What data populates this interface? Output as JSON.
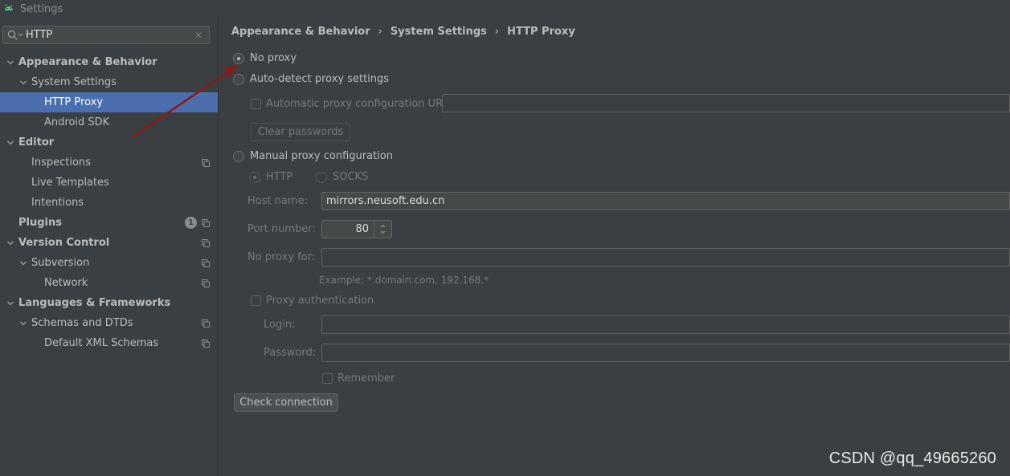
{
  "window": {
    "title": "Settings"
  },
  "search": {
    "value": "HTTP"
  },
  "tree": [
    {
      "label": "Appearance & Behavior",
      "level": 0,
      "expand": "open",
      "bold": true
    },
    {
      "label": "System Settings",
      "level": 1,
      "expand": "open",
      "bold": false
    },
    {
      "label": "HTTP Proxy",
      "level": 2,
      "expand": "none",
      "bold": false,
      "selected": true
    },
    {
      "label": "Android SDK",
      "level": 2,
      "expand": "none",
      "bold": false
    },
    {
      "label": "Editor",
      "level": 0,
      "expand": "open",
      "bold": true
    },
    {
      "label": "Inspections",
      "level": 1,
      "expand": "none",
      "bold": false,
      "copy": true
    },
    {
      "label": "Live Templates",
      "level": 1,
      "expand": "none",
      "bold": false
    },
    {
      "label": "Intentions",
      "level": 1,
      "expand": "none",
      "bold": false
    },
    {
      "label": "Plugins",
      "level": 0,
      "expand": "none",
      "bold": true,
      "copy": true,
      "badge": "1"
    },
    {
      "label": "Version Control",
      "level": 0,
      "expand": "open",
      "bold": true,
      "copy": true
    },
    {
      "label": "Subversion",
      "level": 1,
      "expand": "open",
      "bold": false,
      "copy": true
    },
    {
      "label": "Network",
      "level": 2,
      "expand": "none",
      "bold": false,
      "copy": true
    },
    {
      "label": "Languages & Frameworks",
      "level": 0,
      "expand": "open",
      "bold": true
    },
    {
      "label": "Schemas and DTDs",
      "level": 1,
      "expand": "open",
      "bold": false,
      "copy": true
    },
    {
      "label": "Default XML Schemas",
      "level": 2,
      "expand": "none",
      "bold": false,
      "copy": true
    }
  ],
  "breadcrumb": {
    "items": [
      "Appearance & Behavior",
      "System Settings",
      "HTTP Proxy"
    ],
    "separator": "›"
  },
  "proxy": {
    "no_proxy": "No proxy",
    "auto_detect": "Auto-detect proxy settings",
    "auto_config_url": "Automatic proxy configuration URL:",
    "clear_passwords": "Clear passwords",
    "manual": "Manual proxy configuration",
    "http": "HTTP",
    "socks": "SOCKS",
    "host_label": "Host name:",
    "host_value": "mirrors.neusoft.edu.cn",
    "port_label": "Port number:",
    "port_value": "80",
    "no_proxy_for_label": "No proxy for:",
    "example": "Example: *.domain.com, 192.168.*",
    "proxy_auth": "Proxy authentication",
    "login_label": "Login:",
    "password_label": "Password:",
    "remember": "Remember",
    "check_connection": "Check connection"
  },
  "watermark": "CSDN @qq_49665260",
  "colors": {
    "background": "#3c3f41",
    "selection": "#4b6eaf",
    "annotation_arrow": "#8b1a1a"
  }
}
